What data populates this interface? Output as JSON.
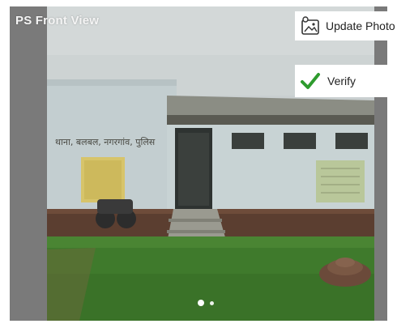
{
  "header": {
    "title": "PS Front View"
  },
  "actions": {
    "update_photo_label": "Update Photo",
    "update_photo_icon": "photo-edit-icon",
    "verify_label": "Verify",
    "verify_icon": "checkmark-icon"
  },
  "photo": {
    "wall_sign": "थाना, बलबल, नगरगांव, पुलिस"
  },
  "carousel": {
    "total_pages": 2,
    "current_page": 1
  },
  "colors": {
    "panel_gray": "#7a7a7a",
    "check_green": "#2e9b2e",
    "grass": "#3f7a2c",
    "wall": "#cfd9da"
  }
}
